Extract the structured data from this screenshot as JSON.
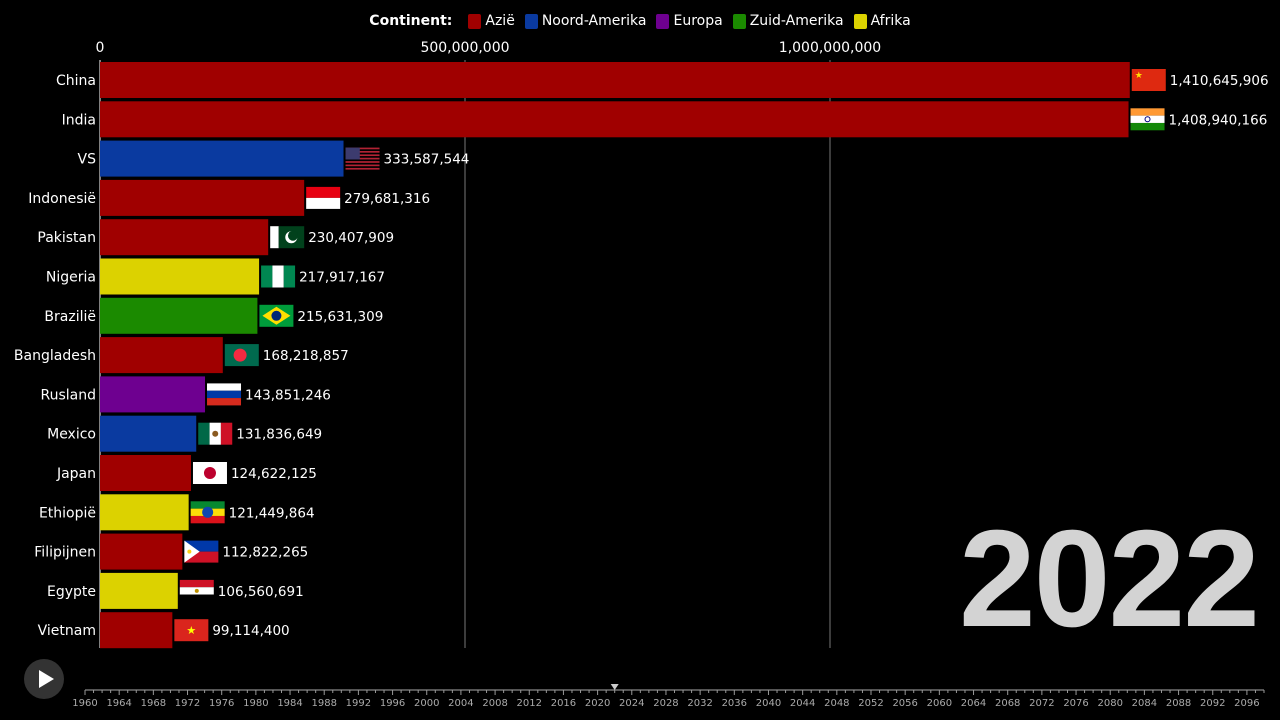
{
  "legend": {
    "title": "Continent:",
    "items": [
      {
        "label": "Azië",
        "color": "#a00000"
      },
      {
        "label": "Noord-Amerika",
        "color": "#0a3aa0"
      },
      {
        "label": "Europa",
        "color": "#6e0090"
      },
      {
        "label": "Zuid-Amerika",
        "color": "#1b8a00"
      },
      {
        "label": "Afrika",
        "color": "#dcd200"
      }
    ]
  },
  "year_label": "2022",
  "chart_data": {
    "type": "bar",
    "orientation": "horizontal",
    "xlim": [
      0,
      1410645906
    ],
    "xticks": [
      0,
      500000000,
      1000000000
    ],
    "xtick_labels": [
      "0",
      "500,000,000",
      "1,000,000,000"
    ],
    "grid": true,
    "legend_position": "top-center",
    "bars": [
      {
        "name": "China",
        "value": 1410645906,
        "value_label": "1,410,645,906",
        "continent": "Azië",
        "flag": "china-flag"
      },
      {
        "name": "India",
        "value": 1408940166,
        "value_label": "1,408,940,166",
        "continent": "Azië",
        "flag": "india-flag"
      },
      {
        "name": "VS",
        "value": 333587544,
        "value_label": "333,587,544",
        "continent": "Noord-Amerika",
        "flag": "usa-flag"
      },
      {
        "name": "Indonesië",
        "value": 279681316,
        "value_label": "279,681,316",
        "continent": "Azië",
        "flag": "indonesia-flag"
      },
      {
        "name": "Pakistan",
        "value": 230407909,
        "value_label": "230,407,909",
        "continent": "Azië",
        "flag": "pakistan-flag"
      },
      {
        "name": "Nigeria",
        "value": 217917167,
        "value_label": "217,917,167",
        "continent": "Afrika",
        "flag": "nigeria-flag"
      },
      {
        "name": "Brazilië",
        "value": 215631309,
        "value_label": "215,631,309",
        "continent": "Zuid-Amerika",
        "flag": "brazil-flag"
      },
      {
        "name": "Bangladesh",
        "value": 168218857,
        "value_label": "168,218,857",
        "continent": "Azië",
        "flag": "bangladesh-flag"
      },
      {
        "name": "Rusland",
        "value": 143851246,
        "value_label": "143,851,246",
        "continent": "Europa",
        "flag": "russia-flag"
      },
      {
        "name": "Mexico",
        "value": 131836649,
        "value_label": "131,836,649",
        "continent": "Noord-Amerika",
        "flag": "mexico-flag"
      },
      {
        "name": "Japan",
        "value": 124622125,
        "value_label": "124,622,125",
        "continent": "Azië",
        "flag": "japan-flag"
      },
      {
        "name": "Ethiopië",
        "value": 121449864,
        "value_label": "121,449,864",
        "continent": "Afrika",
        "flag": "ethiopia-flag"
      },
      {
        "name": "Filipijnen",
        "value": 112822265,
        "value_label": "112,822,265",
        "continent": "Azië",
        "flag": "philippines-flag"
      },
      {
        "name": "Egypte",
        "value": 106560691,
        "value_label": "106,560,691",
        "continent": "Afrika",
        "flag": "egypt-flag"
      },
      {
        "name": "Vietnam",
        "value": 99114400,
        "value_label": "99,114,400",
        "continent": "Azië",
        "flag": "vietnam-flag"
      }
    ]
  },
  "timeline": {
    "start_year": 1960,
    "end_year": 2098,
    "label_years": [
      1960,
      1964,
      1968,
      1972,
      1976,
      1980,
      1984,
      1988,
      1992,
      1996,
      2000,
      2004,
      2008,
      2012,
      2016,
      2020,
      2024,
      2028,
      2032,
      2036,
      2040,
      2044,
      2048,
      2052,
      2056,
      2060,
      2064,
      2068,
      2072,
      2076,
      2080,
      2084,
      2088,
      2092,
      2096
    ],
    "current_year": 2022
  },
  "controls": {
    "play_icon": "play-icon"
  }
}
